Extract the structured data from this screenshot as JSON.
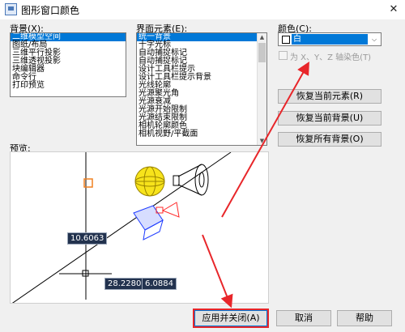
{
  "window": {
    "title": "图形窗口颜色",
    "close_glyph": "✕"
  },
  "context": {
    "label": "背景(X):",
    "items": [
      "二维模型空间",
      "图纸/布局",
      "三维平行投影",
      "三维透视投影",
      "块编辑器",
      "命令行",
      "打印预览"
    ],
    "selected": 0
  },
  "elements": {
    "label": "界面元素(E):",
    "items": [
      "统一背景",
      "十字光标",
      "自动捕捉标记",
      "自动捕捉标记",
      "设计工具栏提示",
      "设计工具栏提示背景",
      "光线轮廓",
      "光源聚光角",
      "光源衰减",
      "光源开始限制",
      "光源结束限制",
      "相机轮廓颜色",
      "相机视野/平截面"
    ],
    "selected": 0
  },
  "color": {
    "label": "颜色(C):",
    "value": "白",
    "dropdown_glyph": "⌵",
    "swatch_color": "#ffffff"
  },
  "tint": {
    "label": "为 X、Y、Z 轴染色(T)",
    "checked": false
  },
  "buttons": {
    "restore_element": "恢复当前元素(R)",
    "restore_context": "恢复当前背景(U)",
    "restore_all": "恢复所有背景(O)",
    "apply_close": "应用并关闭(A)",
    "cancel": "取消",
    "help": "帮助"
  },
  "preview": {
    "label": "预览:",
    "readouts": [
      "10.6063",
      "28.2280",
      "6.0884"
    ]
  },
  "colors": {
    "accent": "#0078d7",
    "annotation": "#e8262a",
    "dark_label": "#22324e"
  }
}
